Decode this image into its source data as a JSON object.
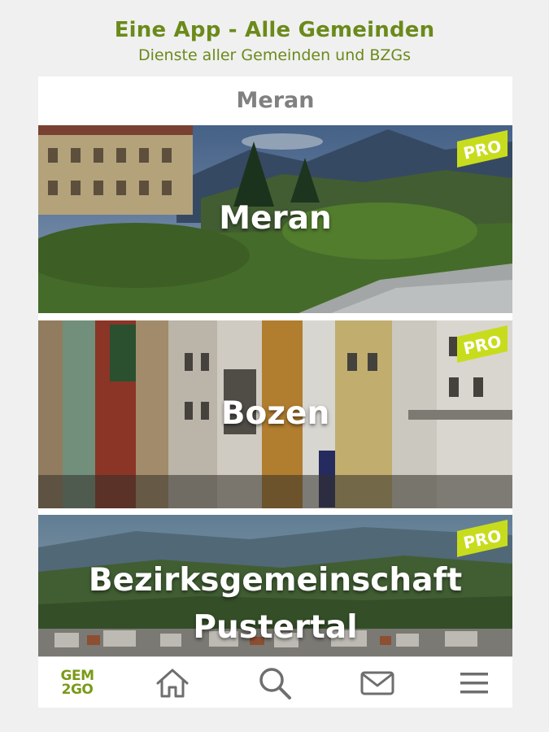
{
  "header": {
    "title": "Eine App - Alle Gemeinden",
    "subtitle": "Dienste aller Gemeinden und BZGs"
  },
  "city_bar": {
    "label": "Meran"
  },
  "cards": [
    {
      "label": "Meran",
      "badge": "PRO"
    },
    {
      "label": "Bozen",
      "badge": "PRO"
    },
    {
      "label_line1": "Bezirksgemeinschaft",
      "label_line2": "Pustertal",
      "badge": "PRO"
    }
  ],
  "tabbar": {
    "logo_line1": "GEM",
    "logo_line2": "2GO",
    "items": [
      "home-icon",
      "search-icon",
      "mail-icon",
      "menu-icon"
    ]
  },
  "colors": {
    "brand_green": "#6b8a1a",
    "badge_green": "#c8dc1e",
    "icon_gray": "#6e6e6e"
  }
}
